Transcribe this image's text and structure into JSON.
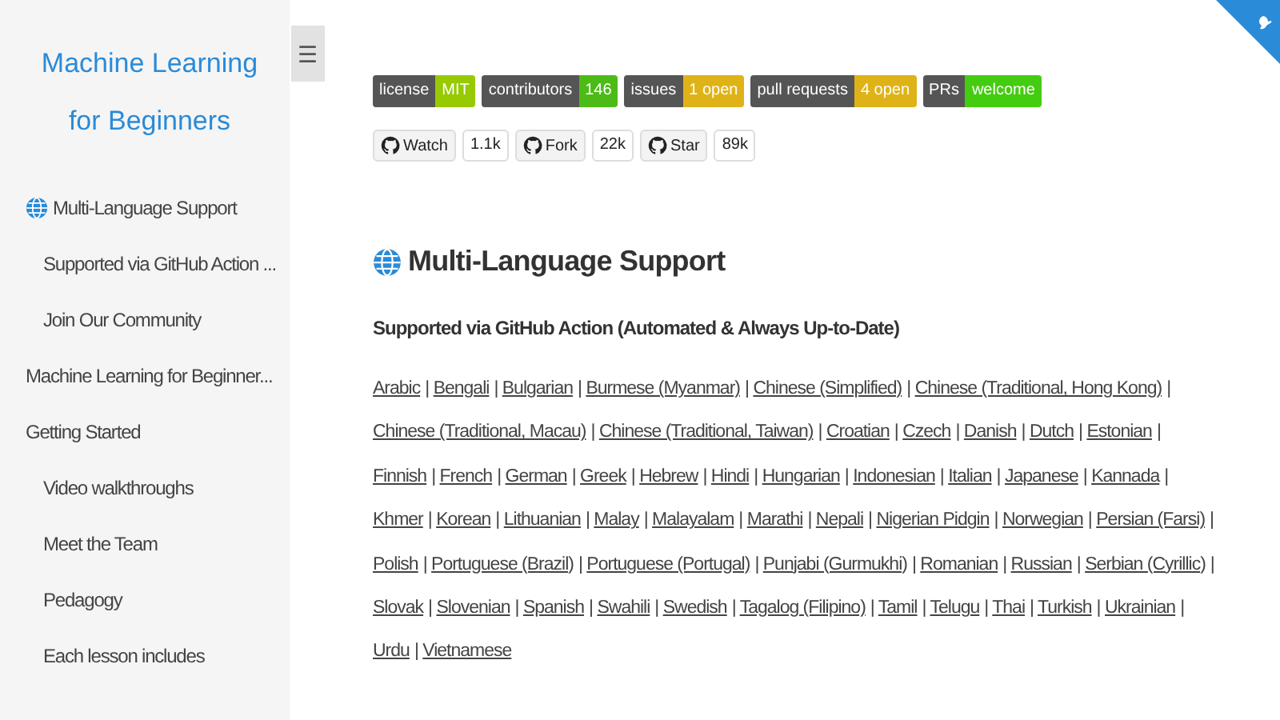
{
  "sidebar": {
    "title": "Machine Learning for Beginners",
    "items": [
      {
        "label": "Multi-Language Support",
        "children": [
          {
            "label": "Supported via GitHub Action ..."
          },
          {
            "label": "Join Our Community"
          }
        ]
      },
      {
        "label": "Machine Learning for Beginner..."
      },
      {
        "label": "Getting Started",
        "children": [
          {
            "label": "Video walkthroughs"
          },
          {
            "label": "Meet the Team"
          },
          {
            "label": "Pedagogy"
          },
          {
            "label": "Each lesson includes"
          }
        ]
      }
    ]
  },
  "menu_button": {
    "label": "☰"
  },
  "badges": [
    {
      "label": "license",
      "value": "MIT",
      "color": "#97ca00"
    },
    {
      "label": "contributors",
      "value": "146",
      "color": "#4cbb17"
    },
    {
      "label": "issues",
      "value": "1 open",
      "color": "#dfb317"
    },
    {
      "label": "pull requests",
      "value": "4 open",
      "color": "#dfb317"
    },
    {
      "label": "PRs",
      "value": "welcome",
      "color": "#44cc11"
    }
  ],
  "social": [
    {
      "label": "Watch",
      "count": "1.1k"
    },
    {
      "label": "Fork",
      "count": "22k"
    },
    {
      "label": "Star",
      "count": "89k"
    }
  ],
  "heading": "Multi-Language Support",
  "subheading": "Supported via GitHub Action (Automated & Always Up-to-Date)",
  "separator": "|",
  "languages": [
    "Arabic",
    "Bengali",
    "Bulgarian",
    "Burmese (Myanmar)",
    "Chinese (Simplified)",
    "Chinese (Traditional, Hong Kong)",
    "Chinese (Traditional, Macau)",
    "Chinese (Traditional, Taiwan)",
    "Croatian",
    "Czech",
    "Danish",
    "Dutch",
    "Estonian",
    "Finnish",
    "French",
    "German",
    "Greek",
    "Hebrew",
    "Hindi",
    "Hungarian",
    "Indonesian",
    "Italian",
    "Japanese",
    "Kannada",
    "Khmer",
    "Korean",
    "Lithuanian",
    "Malay",
    "Malayalam",
    "Marathi",
    "Nepali",
    "Nigerian Pidgin",
    "Norwegian",
    "Persian (Farsi)",
    "Polish",
    "Portuguese (Brazil)",
    "Portuguese (Portugal)",
    "Punjabi (Gurmukhi)",
    "Romanian",
    "Russian",
    "Serbian (Cyrillic)",
    "Slovak",
    "Slovenian",
    "Spanish",
    "Swahili",
    "Swedish",
    "Tagalog (Filipino)",
    "Tamil",
    "Telugu",
    "Thai",
    "Turkish",
    "Ukrainian",
    "Urdu",
    "Vietnamese"
  ]
}
